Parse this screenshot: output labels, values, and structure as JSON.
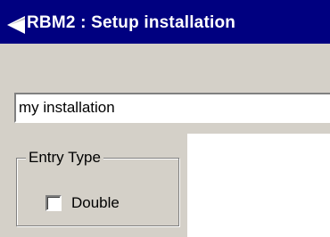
{
  "window": {
    "title": "RBM2 : Setup installation",
    "icon": "back-arrow-icon",
    "titlebar_color": "#000080"
  },
  "installation_name": {
    "value": "my installation"
  },
  "entry_type": {
    "group_label": "Entry Type",
    "double": {
      "label": "Double",
      "checked": false
    }
  }
}
